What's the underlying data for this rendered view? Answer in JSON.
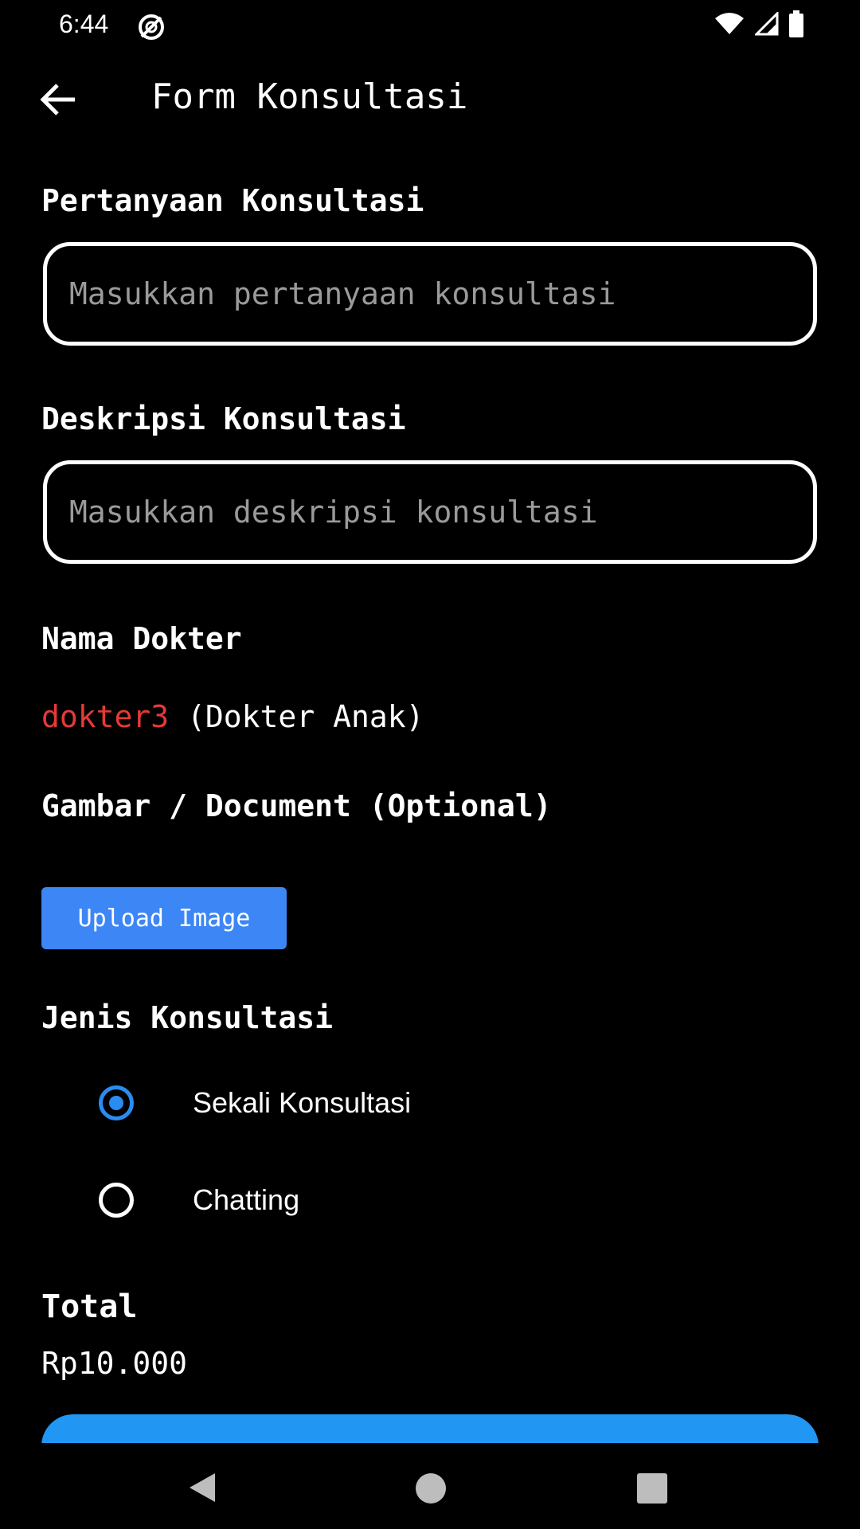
{
  "status_bar": {
    "time": "6:44"
  },
  "app_bar": {
    "title": "Form Konsultasi"
  },
  "form": {
    "question_label": "Pertanyaan Konsultasi",
    "question_placeholder": "Masukkan pertanyaan konsultasi",
    "question_value": "",
    "description_label": "Deskripsi Konsultasi",
    "description_placeholder": "Masukkan deskripsi konsultasi",
    "description_value": "",
    "doctor_label": "Nama Dokter",
    "doctor_name": "dokter3",
    "doctor_specialty": "(Dokter Anak)",
    "attachment_label": "Gambar / Document (Optional)",
    "upload_button": "Upload Image",
    "type_label": "Jenis Konsultasi",
    "type_options": [
      {
        "label": "Sekali Konsultasi",
        "selected": true
      },
      {
        "label": "Chatting",
        "selected": false
      }
    ],
    "total_label": "Total",
    "total_value": "Rp10.000"
  },
  "colors": {
    "background": "#000000",
    "accent": "#2196f3",
    "upload_button": "#3d86f5",
    "doctor_name": "#e53935"
  },
  "icons": [
    "sync-icon",
    "wifi-icon",
    "signal-icon",
    "battery-icon",
    "back-arrow-icon",
    "nav-back-icon",
    "nav-home-icon",
    "nav-recents-icon"
  ]
}
